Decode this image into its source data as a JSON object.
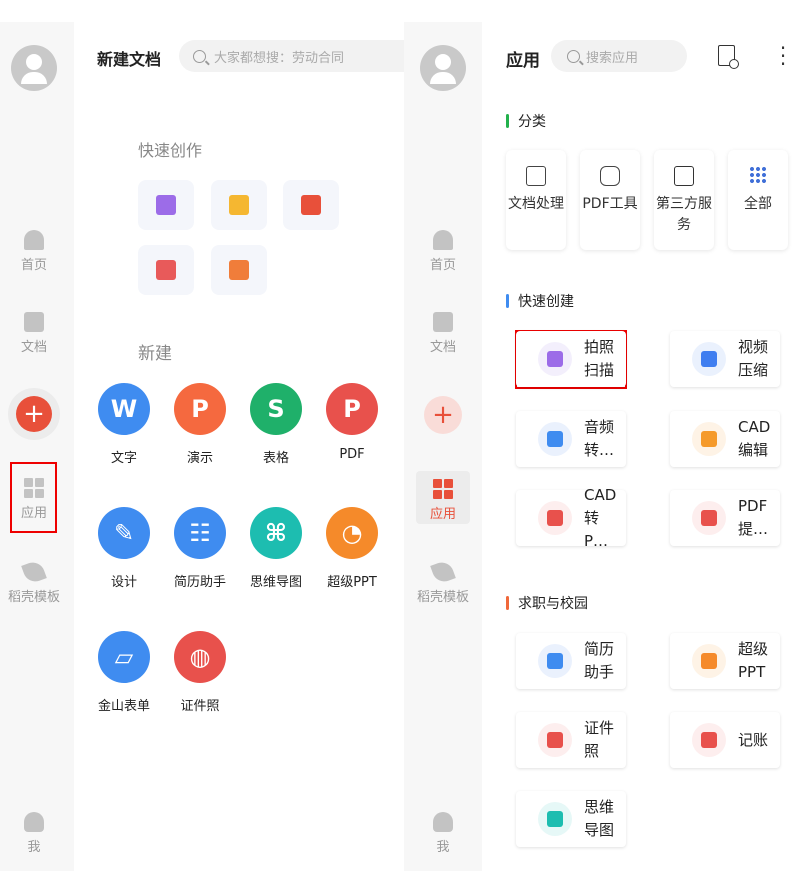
{
  "left": {
    "nav": [
      "首页",
      "文档",
      "应用",
      "稻壳模板",
      "我"
    ],
    "title": "新建文档",
    "search_placeholder": "大家都想搜：劳动合同",
    "quick_title": "快速创作",
    "quick_icons": [
      {
        "icon": "scan-icon",
        "color": "#9c6ce8"
      },
      {
        "icon": "new-file-icon",
        "color": "#f5b731"
      },
      {
        "icon": "person-icon",
        "color": "#e8503a"
      },
      {
        "icon": "book-search-icon",
        "color": "#e85a5a"
      },
      {
        "icon": "image-doc-icon",
        "color": "#f07d3a"
      }
    ],
    "new_title": "新建",
    "apps": [
      {
        "label": "文字",
        "glyph": "W",
        "color": "#3f8cf0"
      },
      {
        "label": "演示",
        "glyph": "P",
        "color": "#f5693f"
      },
      {
        "label": "表格",
        "glyph": "S",
        "color": "#1fb06a"
      },
      {
        "label": "PDF",
        "glyph": "P",
        "color": "#e8514c"
      },
      {
        "label": "设计",
        "glyph": "✎",
        "color": "#3f8cf0"
      },
      {
        "label": "简历助手",
        "glyph": "☷",
        "color": "#3f8cf0"
      },
      {
        "label": "思维导图",
        "glyph": "⌘",
        "color": "#1dbdb0"
      },
      {
        "label": "超级PPT",
        "glyph": "◔",
        "color": "#f58a2a"
      },
      {
        "label": "金山表单",
        "glyph": "▱",
        "color": "#3f8cf0"
      },
      {
        "label": "证件照",
        "glyph": "◍",
        "color": "#e8514c"
      }
    ]
  },
  "right": {
    "nav": [
      "首页",
      "文档",
      "应用",
      "稻壳模板",
      "我"
    ],
    "title": "应用",
    "search_placeholder": "搜索应用",
    "sections": {
      "category": "分类",
      "quick": "快速创建",
      "career": "求职与校园"
    },
    "section_colors": {
      "category": "#22b14c",
      "quick": "#3f8cf0",
      "career": "#f0683a"
    },
    "categories": [
      "文档处理",
      "PDF工具",
      "第三方服务",
      "全部"
    ],
    "quick": [
      {
        "label": "拍照扫描",
        "color": "#9c6ce8",
        "bg": "#f3effc"
      },
      {
        "label": "视频压缩",
        "color": "#3f7ef0",
        "bg": "#eaf1fd"
      },
      {
        "label": "音频转…",
        "color": "#3f8cf0",
        "bg": "#eaf1fd"
      },
      {
        "label": "CAD编辑",
        "color": "#f59a2a",
        "bg": "#fef3e6"
      },
      {
        "label": "CAD转P…",
        "color": "#e8514c",
        "bg": "#fdeeee"
      },
      {
        "label": "PDF提…",
        "color": "#e8514c",
        "bg": "#fdeeee"
      }
    ],
    "career": [
      {
        "label": "简历助手",
        "color": "#3f8cf0",
        "bg": "#eaf1fd"
      },
      {
        "label": "超级PPT",
        "color": "#f58a2a",
        "bg": "#fef3e6"
      },
      {
        "label": "证件照",
        "color": "#e8514c",
        "bg": "#fdeeee"
      },
      {
        "label": "记账",
        "color": "#e8514c",
        "bg": "#fdeeee"
      },
      {
        "label": "思维导图",
        "color": "#1dbdb0",
        "bg": "#e6f8f7"
      }
    ]
  }
}
